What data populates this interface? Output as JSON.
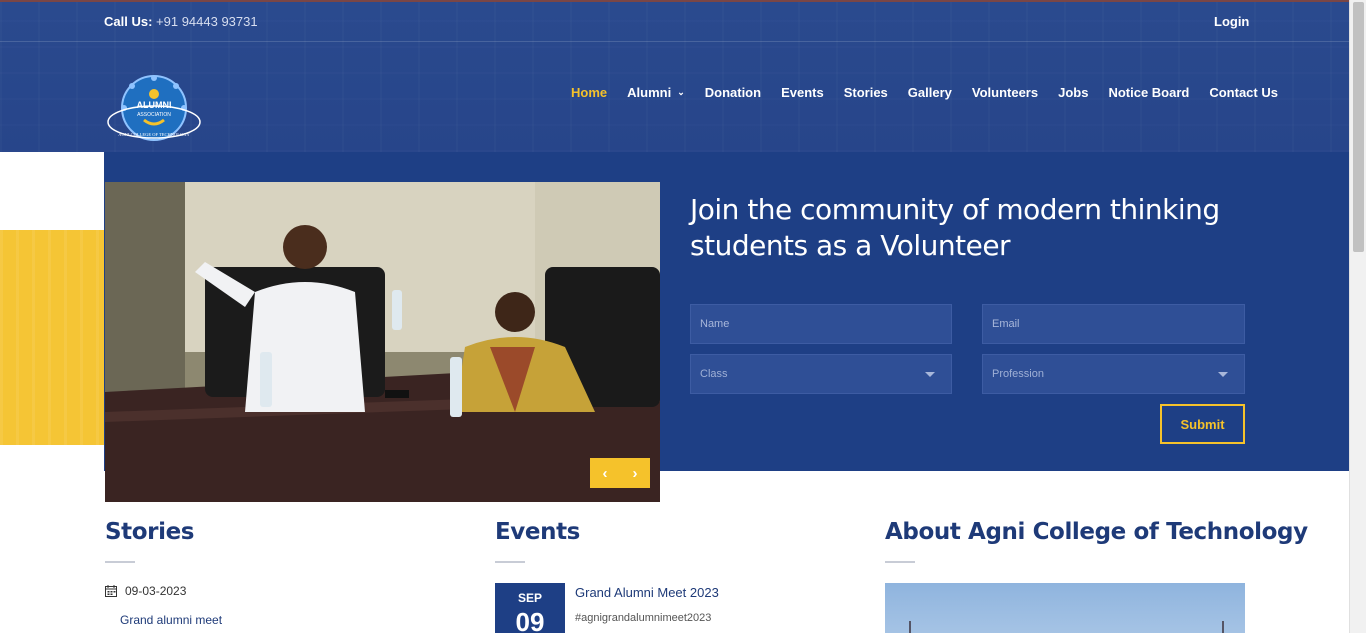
{
  "topbar": {
    "call_label": "Call Us:",
    "call_number": "+91 94443 93731",
    "login": "Login"
  },
  "logo": {
    "line1": "ALUMNI",
    "line2": "ASSOCIATION",
    "line3": "AGNI COLLEGE OF TECHNOLOGY"
  },
  "nav": {
    "items": [
      {
        "label": "Home",
        "active": true
      },
      {
        "label": "Alumni",
        "dropdown": true
      },
      {
        "label": "Donation"
      },
      {
        "label": "Events"
      },
      {
        "label": "Stories"
      },
      {
        "label": "Gallery"
      },
      {
        "label": "Volunteers"
      },
      {
        "label": "Jobs"
      },
      {
        "label": "Notice Board"
      },
      {
        "label": "Contact Us"
      }
    ]
  },
  "hero": {
    "title_line1": "Join the community of modern thinking",
    "title_line2": "students as a Volunteer",
    "form": {
      "name_placeholder": "Name",
      "email_placeholder": "Email",
      "class_value": "Class",
      "profession_value": "Profession",
      "submit": "Submit"
    },
    "slider_prev": "‹",
    "slider_next": "›"
  },
  "stories": {
    "title": "Stories",
    "date": "09-03-2023",
    "item": "Grand alumni meet"
  },
  "events": {
    "title": "Events",
    "month": "SEP",
    "day": "09",
    "item_title": "Grand Alumni Meet 2023",
    "item_tag": "#agnigrandalumnimeet2023"
  },
  "about": {
    "title": "About Agni College of Technology"
  },
  "colors": {
    "primary": "#1e3f85",
    "accent": "#f5c22b",
    "header": "#2a4a8e"
  }
}
